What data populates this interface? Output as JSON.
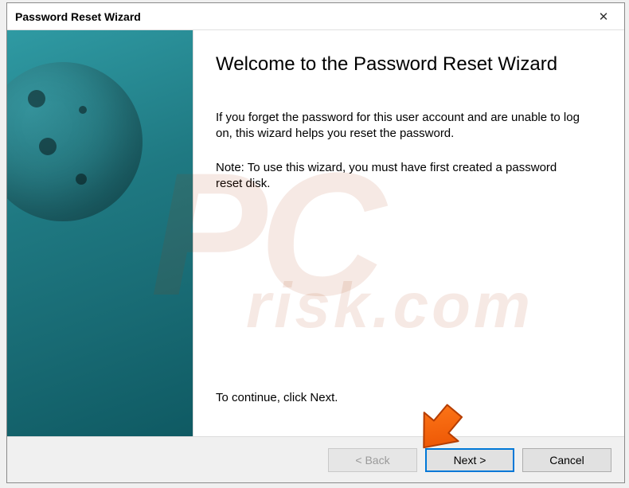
{
  "window": {
    "title": "Password Reset Wizard"
  },
  "content": {
    "heading": "Welcome to the Password Reset Wizard",
    "paragraph1": "If you forget the password for this user account and are unable to log on, this wizard helps you reset the password.",
    "paragraph2": "Note: To use this wizard, you must have first created a password reset disk.",
    "continueHint": "To continue, click Next."
  },
  "buttons": {
    "back": "< Back",
    "next": "Next >",
    "cancel": "Cancel"
  },
  "watermark": {
    "big": "PC",
    "small": "risk.com"
  }
}
